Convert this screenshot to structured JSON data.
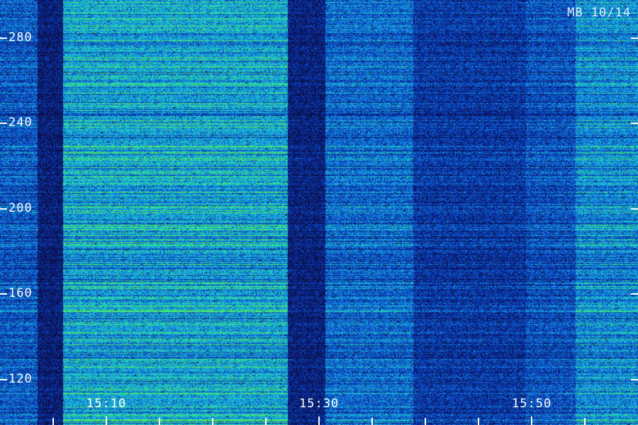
{
  "chart_data": {
    "type": "heatmap",
    "title": "MB 10/14",
    "xlabel": "",
    "ylabel": "",
    "x_tick_labels": [
      "15:10",
      "15:30",
      "15:50"
    ],
    "x_range": [
      "15:05",
      "15:56"
    ],
    "y_tick_labels": [
      "120",
      "160",
      "200",
      "240",
      "280"
    ],
    "y_range": [
      113,
      296
    ],
    "colormap": [
      "#0a0a2a",
      "#0a1a80",
      "#0a50d0",
      "#1aa0e8",
      "#20e0b0",
      "#60f030",
      "#c0ff20"
    ],
    "intensity_segments": [
      {
        "start": "15:05",
        "end": "15:08",
        "level": 0.45
      },
      {
        "start": "15:08",
        "end": "15:10",
        "level": 0.2
      },
      {
        "start": "15:10",
        "end": "15:28",
        "level": 0.68
      },
      {
        "start": "15:28",
        "end": "15:31",
        "level": 0.22
      },
      {
        "start": "15:31",
        "end": "15:38",
        "level": 0.5
      },
      {
        "start": "15:38",
        "end": "15:47",
        "level": 0.33
      },
      {
        "start": "15:47",
        "end": "15:51",
        "level": 0.42
      },
      {
        "start": "15:51",
        "end": "15:56",
        "level": 0.6
      }
    ]
  }
}
